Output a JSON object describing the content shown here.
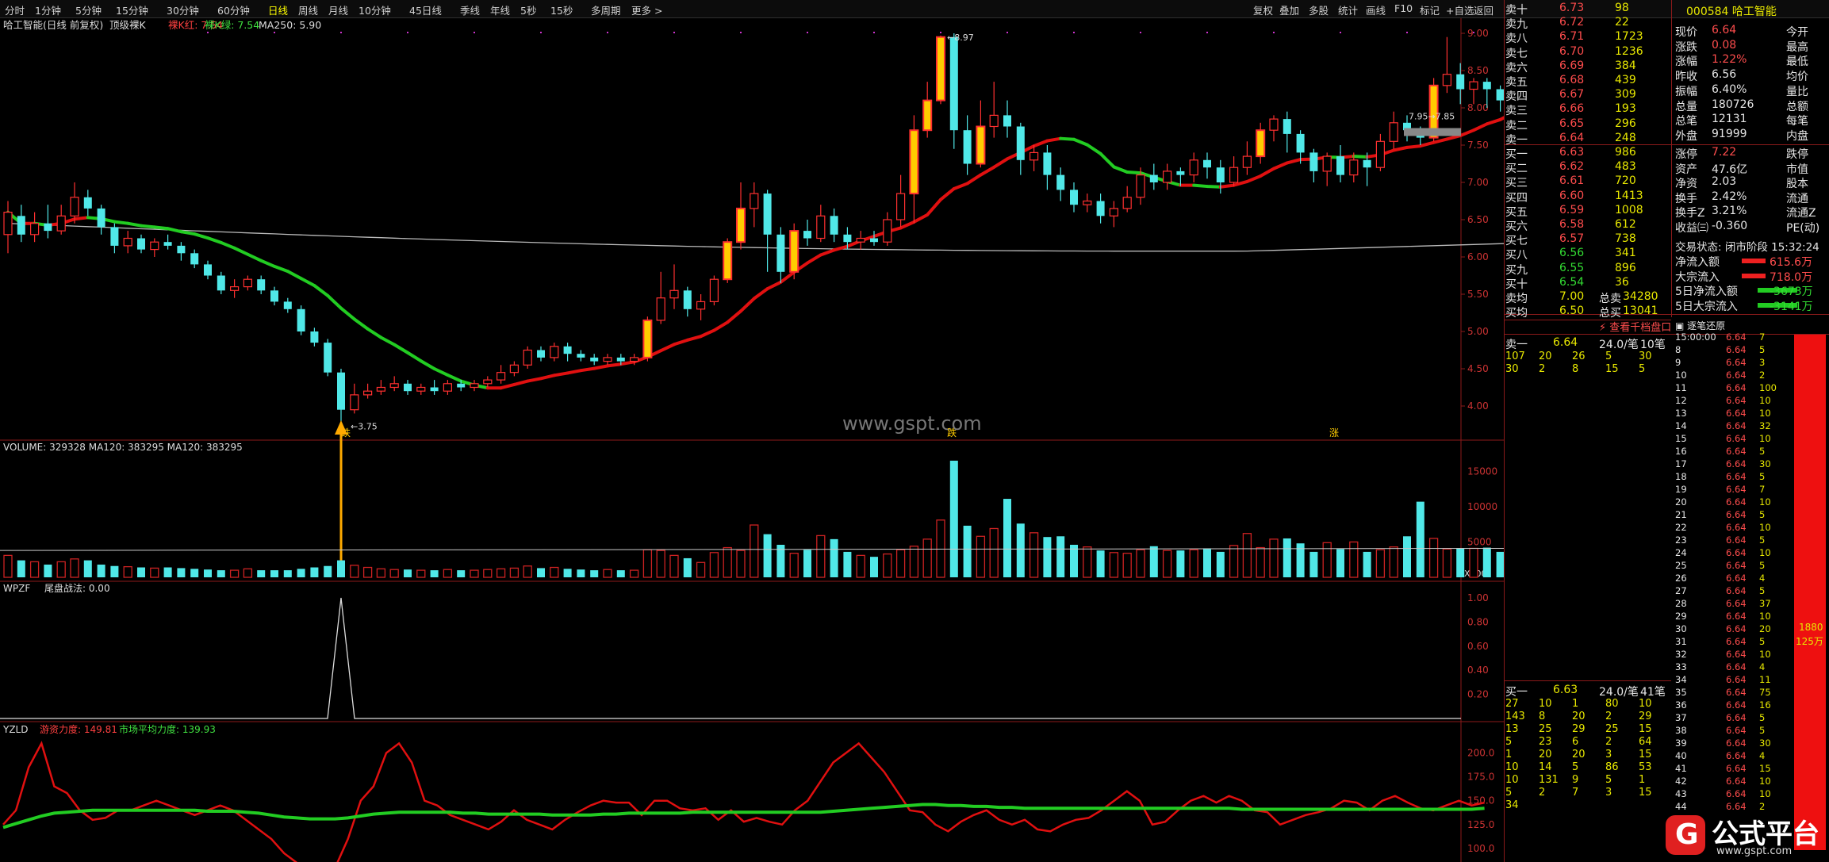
{
  "toolbar": {
    "periods": [
      "分时",
      "1分钟",
      "5分钟",
      "15分钟",
      "30分钟",
      "60分钟",
      "日线",
      "周线",
      "月线",
      "10分钟",
      "45日线",
      "季线",
      "年线",
      "5秒",
      "15秒",
      "多周期",
      "更多 >"
    ],
    "tools": [
      "复权",
      "叠加",
      "多股",
      "统计",
      "画线",
      "F10",
      "标记",
      "+自选",
      "返回"
    ]
  },
  "header": {
    "stock": "哈工智能(日线 前复权)",
    "indicator": "顶级裸K",
    "redk": "裸K红: 7.54",
    "greenk": "裸K绿: 7.54",
    "ma": "MA250: 5.90"
  },
  "price_axis": [
    "9.00",
    "8.50",
    "8.00",
    "7.50",
    "7.00",
    "6.50",
    "6.00",
    "5.50",
    "5.00",
    "4.50",
    "4.00"
  ],
  "annotations": {
    "high": "8.97",
    "low": "3.75",
    "last": "7.95→7.85",
    "watermark": "www.gspt.com",
    "mark_low": "跌",
    "mark_high": "跌",
    "mark_right": "涨"
  },
  "volume": {
    "label": "VOLUME: 329328  MA120: 383295  MA120: 383295",
    "axis": [
      "15000",
      "10000",
      "5000"
    ],
    "unit": "X100"
  },
  "wpzf": {
    "label": "WPZF",
    "text": "尾盘战法: 0.00",
    "axis": [
      "1.00",
      "0.80",
      "0.60",
      "0.40",
      "0.20"
    ]
  },
  "yzld": {
    "label": "YZLD",
    "l1": "游资力度: 149.81",
    "l2": "市场平均力度: 139.93",
    "axis": [
      "200.0",
      "175.0",
      "150.0",
      "125.0",
      "100.0"
    ]
  },
  "chart_data": {
    "type": "candlestick",
    "candles": [
      [
        6.3,
        6.6,
        6.75,
        6.05
      ],
      [
        6.55,
        6.3,
        6.7,
        6.2
      ],
      [
        6.3,
        6.45,
        6.6,
        6.2
      ],
      [
        6.45,
        6.35,
        6.7,
        6.25
      ],
      [
        6.35,
        6.55,
        6.7,
        6.3
      ],
      [
        6.55,
        6.8,
        7.0,
        6.45
      ],
      [
        6.8,
        6.65,
        6.9,
        6.55
      ],
      [
        6.65,
        6.4,
        6.7,
        6.3
      ],
      [
        6.4,
        6.15,
        6.45,
        6.05
      ],
      [
        6.15,
        6.25,
        6.35,
        6.05
      ],
      [
        6.25,
        6.1,
        6.3,
        6.05
      ],
      [
        6.1,
        6.2,
        6.25,
        6.0
      ],
      [
        6.2,
        6.15,
        6.3,
        6.1
      ],
      [
        6.15,
        6.05,
        6.2,
        5.95
      ],
      [
        6.05,
        5.9,
        6.1,
        5.85
      ],
      [
        5.9,
        5.75,
        5.95,
        5.7
      ],
      [
        5.75,
        5.55,
        5.8,
        5.5
      ],
      [
        5.55,
        5.6,
        5.7,
        5.45
      ],
      [
        5.6,
        5.7,
        5.75,
        5.55
      ],
      [
        5.7,
        5.55,
        5.75,
        5.5
      ],
      [
        5.55,
        5.4,
        5.6,
        5.35
      ],
      [
        5.4,
        5.3,
        5.45,
        5.25
      ],
      [
        5.3,
        5.0,
        5.35,
        4.95
      ],
      [
        5.0,
        4.85,
        5.05,
        4.8
      ],
      [
        4.85,
        4.45,
        4.9,
        4.4
      ],
      [
        4.45,
        3.95,
        4.5,
        3.75
      ],
      [
        3.95,
        4.15,
        4.3,
        3.9
      ],
      [
        4.15,
        4.2,
        4.3,
        4.1
      ],
      [
        4.2,
        4.25,
        4.35,
        4.15
      ],
      [
        4.25,
        4.3,
        4.4,
        4.2
      ],
      [
        4.3,
        4.2,
        4.35,
        4.15
      ],
      [
        4.2,
        4.25,
        4.3,
        4.15
      ],
      [
        4.25,
        4.2,
        4.35,
        4.15
      ],
      [
        4.2,
        4.3,
        4.35,
        4.15
      ],
      [
        4.3,
        4.25,
        4.35,
        4.2
      ],
      [
        4.25,
        4.3,
        4.35,
        4.2
      ],
      [
        4.3,
        4.35,
        4.4,
        4.25
      ],
      [
        4.35,
        4.45,
        4.55,
        4.3
      ],
      [
        4.45,
        4.55,
        4.6,
        4.4
      ],
      [
        4.55,
        4.75,
        4.8,
        4.5
      ],
      [
        4.75,
        4.65,
        4.8,
        4.6
      ],
      [
        4.65,
        4.8,
        4.85,
        4.6
      ],
      [
        4.8,
        4.7,
        4.85,
        4.6
      ],
      [
        4.7,
        4.65,
        4.75,
        4.6
      ],
      [
        4.65,
        4.6,
        4.7,
        4.55
      ],
      [
        4.6,
        4.65,
        4.7,
        4.55
      ],
      [
        4.65,
        4.6,
        4.7,
        4.55
      ],
      [
        4.6,
        4.65,
        4.7,
        4.55
      ],
      [
        4.65,
        5.15,
        5.2,
        4.6
      ],
      [
        5.15,
        5.45,
        5.8,
        5.1
      ],
      [
        5.45,
        5.55,
        5.9,
        5.3
      ],
      [
        5.55,
        5.3,
        5.6,
        5.2
      ],
      [
        5.3,
        5.4,
        5.5,
        5.15
      ],
      [
        5.4,
        5.7,
        5.75,
        5.35
      ],
      [
        5.7,
        6.2,
        6.25,
        5.65
      ],
      [
        6.2,
        6.65,
        7.0,
        6.1
      ],
      [
        6.65,
        6.85,
        7.0,
        6.4
      ],
      [
        6.85,
        6.3,
        6.9,
        5.8
      ],
      [
        6.3,
        5.8,
        6.4,
        5.65
      ],
      [
        5.8,
        6.35,
        6.45,
        5.7
      ],
      [
        6.35,
        6.25,
        6.5,
        6.15
      ],
      [
        6.25,
        6.55,
        6.7,
        6.2
      ],
      [
        6.55,
        6.3,
        6.65,
        6.2
      ],
      [
        6.3,
        6.2,
        6.4,
        6.1
      ],
      [
        6.2,
        6.25,
        6.35,
        6.1
      ],
      [
        6.25,
        6.2,
        6.35,
        6.15
      ],
      [
        6.2,
        6.5,
        6.6,
        6.15
      ],
      [
        6.5,
        6.85,
        7.1,
        6.4
      ],
      [
        6.85,
        7.7,
        7.9,
        6.45
      ],
      [
        7.7,
        8.1,
        8.35,
        7.6
      ],
      [
        8.1,
        8.95,
        8.97,
        8.05
      ],
      [
        8.95,
        7.7,
        9.0,
        7.45
      ],
      [
        7.7,
        7.25,
        7.9,
        7.1
      ],
      [
        7.25,
        7.75,
        8.1,
        7.2
      ],
      [
        7.75,
        7.9,
        8.35,
        7.6
      ],
      [
        7.9,
        7.75,
        8.1,
        7.6
      ],
      [
        7.75,
        7.3,
        7.8,
        7.1
      ],
      [
        7.3,
        7.4,
        7.5,
        7.15
      ],
      [
        7.4,
        7.1,
        7.5,
        6.9
      ],
      [
        7.1,
        6.9,
        7.2,
        6.75
      ],
      [
        6.9,
        6.7,
        7.0,
        6.6
      ],
      [
        6.7,
        6.75,
        6.85,
        6.6
      ],
      [
        6.75,
        6.55,
        6.85,
        6.45
      ],
      [
        6.55,
        6.65,
        6.75,
        6.4
      ],
      [
        6.65,
        6.8,
        6.95,
        6.6
      ],
      [
        6.8,
        7.1,
        7.2,
        6.7
      ],
      [
        7.1,
        7.0,
        7.25,
        6.9
      ],
      [
        7.0,
        7.15,
        7.25,
        6.9
      ],
      [
        7.15,
        7.1,
        7.2,
        6.95
      ],
      [
        7.1,
        7.3,
        7.4,
        7.0
      ],
      [
        7.3,
        7.2,
        7.4,
        7.05
      ],
      [
        7.2,
        7.0,
        7.3,
        6.85
      ],
      [
        7.0,
        7.2,
        7.35,
        6.95
      ],
      [
        7.2,
        7.35,
        7.55,
        7.1
      ],
      [
        7.35,
        7.7,
        7.8,
        7.25
      ],
      [
        7.7,
        7.85,
        7.9,
        7.55
      ],
      [
        7.85,
        7.65,
        7.95,
        7.4
      ],
      [
        7.65,
        7.4,
        7.7,
        7.25
      ],
      [
        7.4,
        7.15,
        7.45,
        7.0
      ],
      [
        7.15,
        7.35,
        7.4,
        6.95
      ],
      [
        7.35,
        7.1,
        7.5,
        7.0
      ],
      [
        7.1,
        7.3,
        7.4,
        7.0
      ],
      [
        7.3,
        7.2,
        7.4,
        6.95
      ],
      [
        7.2,
        7.55,
        7.65,
        7.15
      ],
      [
        7.55,
        7.8,
        7.95,
        7.45
      ],
      [
        7.8,
        7.7,
        7.9,
        7.55
      ],
      [
        7.7,
        7.6,
        7.75,
        7.5
      ],
      [
        7.6,
        8.3,
        8.4,
        7.55
      ],
      [
        8.3,
        8.45,
        8.95,
        8.2
      ],
      [
        8.45,
        8.25,
        8.6,
        8.05
      ],
      [
        8.25,
        8.35,
        8.4,
        8.05
      ],
      [
        8.35,
        8.25,
        8.4,
        8.0
      ],
      [
        8.25,
        8.1,
        8.3,
        7.95
      ],
      [
        8.1,
        8.3,
        8.35,
        8.0
      ],
      [
        8.3,
        7.95,
        8.35,
        7.9
      ],
      [
        7.95,
        7.75,
        8.1,
        7.55
      ]
    ],
    "volume": [
      3.1,
      2.4,
      2.2,
      1.8,
      2.2,
      2.6,
      2.4,
      1.8,
      1.6,
      1.5,
      1.4,
      1.3,
      1.4,
      1.3,
      1.2,
      1.1,
      1.0,
      1.0,
      1.2,
      1.0,
      1.0,
      1.0,
      1.2,
      1.4,
      1.6,
      2.4,
      1.7,
      1.4,
      1.2,
      1.1,
      1.1,
      1.0,
      1.0,
      1.1,
      1.0,
      1.0,
      1.1,
      1.2,
      1.3,
      1.6,
      1.3,
      1.4,
      1.2,
      1.1,
      1.0,
      1.1,
      1.0,
      1.0,
      3.9,
      3.8,
      3.1,
      2.7,
      2.1,
      3.5,
      4.2,
      3.8,
      7.4,
      6.1,
      4.6,
      3.4,
      3.9,
      5.9,
      5.4,
      3.6,
      3.1,
      2.9,
      3.3,
      3.9,
      4.4,
      5.4,
      8.1,
      16.5,
      7.3,
      5.8,
      6.9,
      11.1,
      7.6,
      6.3,
      5.7,
      5.8,
      4.6,
      4.3,
      3.8,
      3.5,
      3.4,
      3.9,
      4.4,
      3.8,
      3.8,
      3.9,
      4.1,
      3.6,
      4.5,
      6.2,
      4.2,
      5.4,
      5.5,
      4.8,
      3.6,
      4.9,
      4.0,
      5.0,
      3.6,
      3.9,
      4.3,
      5.8,
      10.7,
      5.5,
      4.0,
      4.1,
      4.1,
      4.2,
      3.6,
      3.2
    ],
    "ma_green": [],
    "wpzf_spike_index": 25,
    "yzld_red": [
      125,
      140,
      185,
      210,
      165,
      158,
      140,
      130,
      132,
      140,
      140,
      145,
      150,
      145,
      140,
      135,
      140,
      145,
      140,
      130,
      120,
      110,
      95,
      85,
      75,
      72,
      80,
      110,
      150,
      165,
      200,
      210,
      190,
      150,
      145,
      135,
      130,
      125,
      120,
      128,
      140,
      130,
      125,
      120,
      130,
      138,
      145,
      150,
      148,
      148,
      135,
      150,
      150,
      142,
      140,
      142,
      130,
      140,
      128,
      132,
      128,
      125,
      140,
      150,
      170,
      190,
      200,
      210,
      195,
      180,
      160,
      140,
      138,
      125,
      118,
      128,
      135,
      140,
      130,
      125,
      130,
      120,
      118,
      125,
      130,
      132,
      140,
      150,
      160,
      150,
      125,
      128,
      140,
      150,
      155,
      148,
      155,
      150,
      140,
      138,
      125,
      130,
      135,
      138,
      142,
      150,
      148,
      140,
      150,
      155,
      148,
      142,
      140,
      145,
      150,
      145,
      148
    ],
    "yzld_green": [
      122,
      126,
      130,
      134,
      137,
      138,
      139,
      140,
      140,
      140,
      140,
      140,
      140,
      140,
      140,
      140,
      139,
      139,
      139,
      138,
      137,
      135,
      133,
      132,
      131,
      131,
      131,
      132,
      134,
      136,
      137,
      138,
      138,
      138,
      138,
      138,
      137,
      137,
      136,
      136,
      136,
      136,
      136,
      135,
      135,
      135,
      135,
      136,
      136,
      137,
      137,
      137,
      137,
      137,
      138,
      138,
      138,
      138,
      138,
      138,
      138,
      138,
      138,
      138,
      138,
      139,
      140,
      141,
      142,
      143,
      144,
      145,
      146,
      146,
      145,
      145,
      144,
      144,
      143,
      143,
      142,
      142,
      142,
      142,
      142,
      142,
      142,
      142,
      142,
      142,
      142,
      142,
      142,
      142,
      142,
      142,
      142,
      141,
      141,
      141,
      141,
      141,
      141,
      141,
      141,
      141,
      141,
      141,
      141,
      141,
      141,
      141,
      141,
      141,
      141,
      141,
      142
    ]
  },
  "quote": {
    "code": "000584 哈工智能",
    "sells": [
      [
        "卖十",
        "6.73",
        "98"
      ],
      [
        "卖九",
        "6.72",
        "22"
      ],
      [
        "卖八",
        "6.71",
        "1723"
      ],
      [
        "卖七",
        "6.70",
        "1236"
      ],
      [
        "卖六",
        "6.69",
        "384"
      ],
      [
        "卖五",
        "6.68",
        "439"
      ],
      [
        "卖四",
        "6.67",
        "309"
      ],
      [
        "卖三",
        "6.66",
        "193"
      ],
      [
        "卖二",
        "6.65",
        "296"
      ],
      [
        "卖一",
        "6.64",
        "248"
      ]
    ],
    "buys": [
      [
        "买一",
        "6.63",
        "986"
      ],
      [
        "买二",
        "6.62",
        "483"
      ],
      [
        "买三",
        "6.61",
        "720"
      ],
      [
        "买四",
        "6.60",
        "1413"
      ],
      [
        "买五",
        "6.59",
        "1008"
      ],
      [
        "买六",
        "6.58",
        "612"
      ],
      [
        "买七",
        "6.57",
        "738"
      ],
      [
        "买八",
        "6.56",
        "341"
      ],
      [
        "买九",
        "6.55",
        "896"
      ],
      [
        "买十",
        "6.54",
        "36"
      ]
    ],
    "avg": [
      [
        "卖均",
        "7.00",
        "总卖",
        "34280"
      ],
      [
        "买均",
        "6.50",
        "总买",
        "13041"
      ]
    ],
    "stats": [
      [
        "现价",
        "6.64",
        "今开"
      ],
      [
        "涨跌",
        "0.08",
        "最高"
      ],
      [
        "涨幅",
        "1.22%",
        "最低"
      ],
      [
        "昨收",
        "6.56",
        "均价"
      ],
      [
        "振幅",
        "6.40%",
        "量比"
      ],
      [
        "总量",
        "180726",
        "总额"
      ],
      [
        "总笔",
        "12131",
        "每笔"
      ],
      [
        "外盘",
        "91999",
        "内盘"
      ]
    ],
    "stats2": [
      [
        "涨停",
        "7.22",
        "跌停"
      ],
      [
        "资产",
        "47.6亿",
        "市值"
      ],
      [
        "净资",
        "2.03",
        "股本"
      ],
      [
        "换手",
        "2.42%",
        "流通"
      ],
      [
        "换手Z",
        "3.21%",
        "流通Z"
      ],
      [
        "收益㈢",
        "-0.360",
        "PE(动)"
      ]
    ],
    "status": "交易状态: 闭市阶段  15:32:24",
    "flows": [
      [
        "净流入额",
        "615.6万"
      ],
      [
        "大宗流入",
        "718.0万"
      ],
      [
        "5日净流入额",
        "-3673万"
      ],
      [
        "5日大宗流入",
        "-3141万"
      ]
    ],
    "link": "查看千档盘口",
    "qsell": [
      "卖一",
      "6.64",
      "24.0/笔",
      "10笔"
    ],
    "qsell_rows": [
      [
        "107",
        "20",
        "26",
        "5",
        "30"
      ],
      [
        "30",
        "2",
        "8",
        "15",
        "5"
      ]
    ],
    "qbuy": [
      "买一",
      "6.63",
      "24.0/笔",
      "41笔"
    ],
    "qbuy_rows": [
      [
        "27",
        "10",
        "1",
        "80",
        "10"
      ],
      [
        "143",
        "8",
        "20",
        "2",
        "29"
      ],
      [
        "13",
        "25",
        "29",
        "25",
        "15"
      ],
      [
        "5",
        "23",
        "6",
        "2",
        "64"
      ],
      [
        "1",
        "20",
        "20",
        "3",
        "15"
      ],
      [
        "10",
        "14",
        "5",
        "86",
        "53"
      ],
      [
        "10",
        "131",
        "9",
        "5",
        "1"
      ],
      [
        "5",
        "2",
        "7",
        "3",
        "15"
      ],
      [
        "34",
        "",
        "",
        "",
        ""
      ]
    ],
    "ticks_title": "逐笔还原",
    "ticks": [
      [
        "15:00:00",
        "6.64",
        "7"
      ],
      [
        "8",
        "6.64",
        "5"
      ],
      [
        "9",
        "6.64",
        "3"
      ],
      [
        "10",
        "6.64",
        "2"
      ],
      [
        "11",
        "6.64",
        "100"
      ],
      [
        "12",
        "6.64",
        "10"
      ],
      [
        "13",
        "6.64",
        "10"
      ],
      [
        "14",
        "6.64",
        "32"
      ],
      [
        "15",
        "6.64",
        "10"
      ],
      [
        "16",
        "6.64",
        "5"
      ],
      [
        "17",
        "6.64",
        "30"
      ],
      [
        "18",
        "6.64",
        "5"
      ],
      [
        "19",
        "6.64",
        "7"
      ],
      [
        "20",
        "6.64",
        "10"
      ],
      [
        "21",
        "6.64",
        "5"
      ],
      [
        "22",
        "6.64",
        "10"
      ],
      [
        "23",
        "6.64",
        "5"
      ],
      [
        "24",
        "6.64",
        "10"
      ],
      [
        "25",
        "6.64",
        "5"
      ],
      [
        "26",
        "6.64",
        "4"
      ],
      [
        "27",
        "6.64",
        "5"
      ],
      [
        "28",
        "6.64",
        "37"
      ],
      [
        "29",
        "6.64",
        "10"
      ],
      [
        "30",
        "6.64",
        "20"
      ],
      [
        "31",
        "6.64",
        "5"
      ],
      [
        "32",
        "6.64",
        "10"
      ],
      [
        "33",
        "6.64",
        "4"
      ],
      [
        "34",
        "6.64",
        "11"
      ],
      [
        "35",
        "6.64",
        "75"
      ],
      [
        "36",
        "6.64",
        "16"
      ],
      [
        "37",
        "6.64",
        "5"
      ],
      [
        "38",
        "6.64",
        "5"
      ],
      [
        "39",
        "6.64",
        "30"
      ],
      [
        "40",
        "6.64",
        "4"
      ],
      [
        "41",
        "6.64",
        "15"
      ],
      [
        "42",
        "6.64",
        "10"
      ],
      [
        "43",
        "6.64",
        "10"
      ],
      [
        "44",
        "6.64",
        "2"
      ]
    ],
    "bar_label": [
      "1880",
      "125万"
    ]
  },
  "logo": {
    "name": "公式平台",
    "url": "www.gspt.com"
  }
}
